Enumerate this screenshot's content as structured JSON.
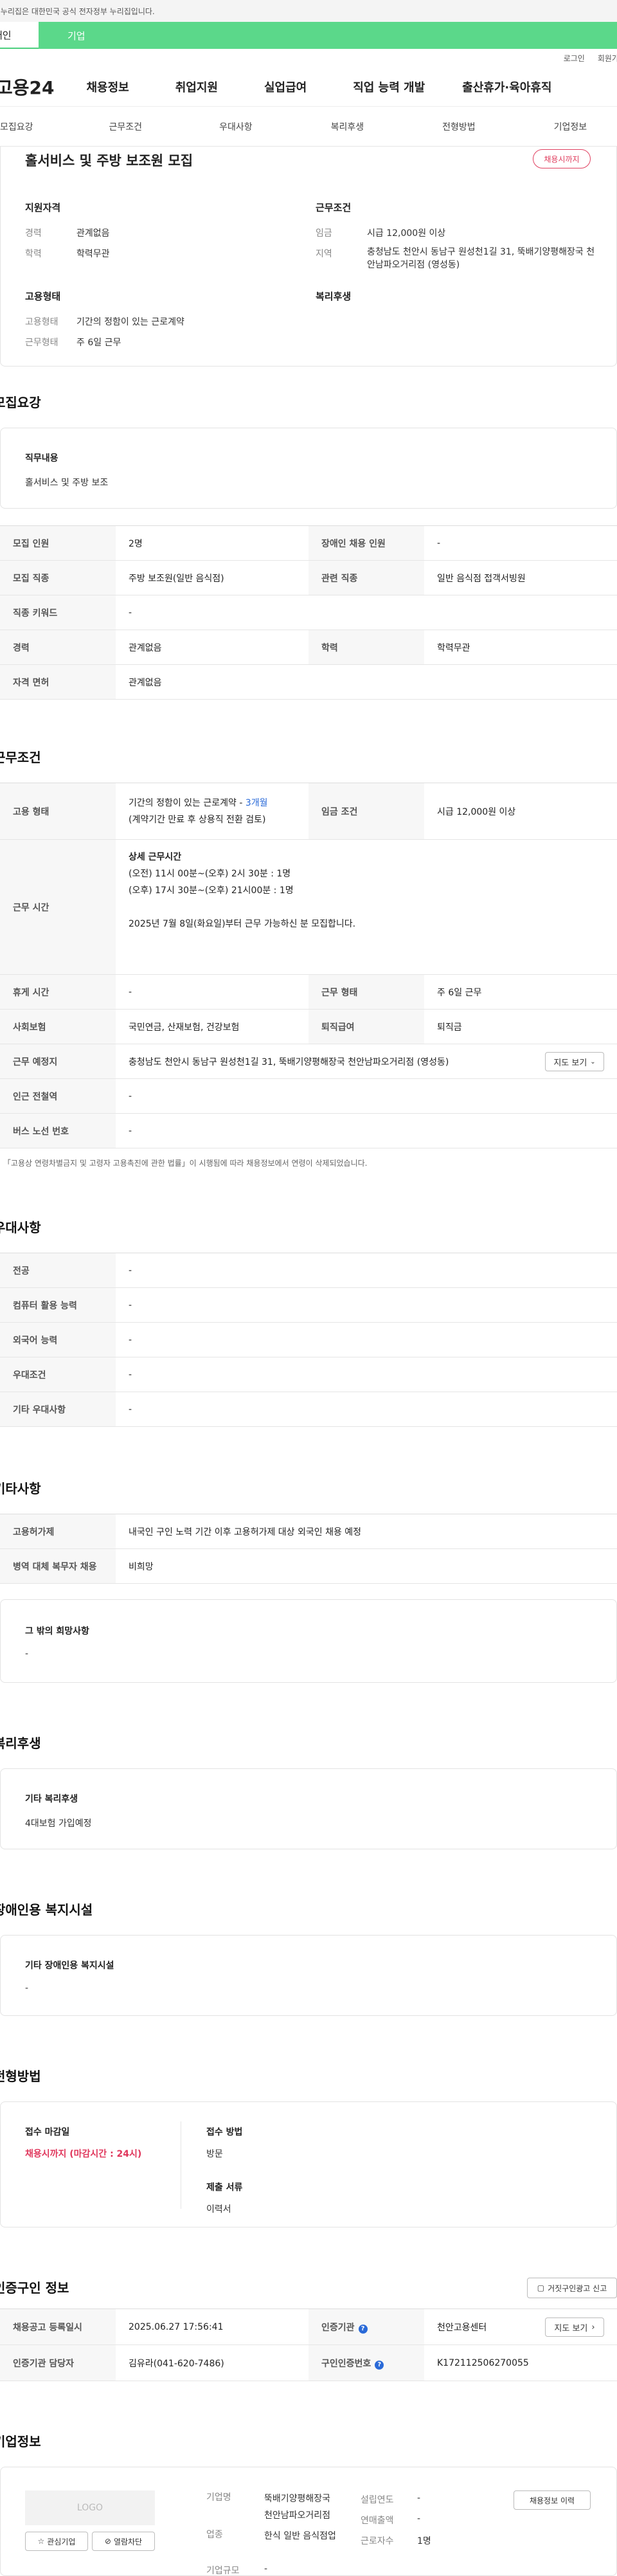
{
  "banner": {
    "text": "이 누리집은 대한민국 공식 전자정부 누리집입니다."
  },
  "loginbar": {
    "person": "개인",
    "company": "기업"
  },
  "util": {
    "login": "로그인",
    "join": "회원가입"
  },
  "gnb": {
    "logo": "고용24",
    "items": [
      "채용정보",
      "취업지원",
      "실업급여",
      "직업 능력 개발",
      "출산휴가·육아휴직"
    ]
  },
  "tabs": [
    "모집요강",
    "근무조건",
    "우대사항",
    "복리후생",
    "전형방법",
    "기업정보"
  ],
  "summary": {
    "title": "홀서비스 및 주방 보조원 모집",
    "badge": "채용시까지",
    "qual_title": "지원자격",
    "career_label": "경력",
    "career_value": "관계없음",
    "edu_label": "학력",
    "edu_value": "학력무관",
    "work_title": "근무조건",
    "wage_label": "임금",
    "wage_value": "시급 12,000원 이상",
    "loc_label": "지역",
    "loc_value": "충청남도 천안시 동남구 원성천1길 31, 뚝배기양평해장국 천안남파오거리점 (영성동)",
    "emp_title": "고용형태",
    "emp_label": "고용형태",
    "emp_value": "기간의 정함이 있는 근로계약",
    "form_label": "근무형태",
    "form_value": "주 6일 근무",
    "welfare_title": "복리후생"
  },
  "recruit": {
    "section_title": "모집요강",
    "duty_title": "직무내용",
    "duty_value": "홀서비스 및 주방 보조",
    "rows": [
      {
        "l1": "모집 인원",
        "v1": "2명",
        "l2": "장애인 채용 인원",
        "v2": "-"
      },
      {
        "l1": "모집 직종",
        "v1": "주방 보조원(일반 음식점)",
        "l2": "관련 직종",
        "v2": "일반 음식점 접객서빙원"
      },
      {
        "l1": "직종 키워드",
        "v1": "-"
      },
      {
        "l1": "경력",
        "v1": "관계없음",
        "l2": "학력",
        "v2": "학력무관"
      },
      {
        "l1": "자격 면허",
        "v1": "관계없음"
      }
    ]
  },
  "work": {
    "section_title": "근무조건",
    "emp_label": "고용 형태",
    "emp_value_a": "기간의 정함이 있는 근로계약 - ",
    "emp_value_b": "3개월",
    "emp_value_c": "(계약기간 만료 후 상용직 전환 검토)",
    "wage_label": "임금 조건",
    "wage_value": "시급 12,000원 이상",
    "time_label": "근무 시간",
    "time_title": "상세 근무시간",
    "time_1": "(오전) 11시 00분~(오후) 2시 30분 : 1명",
    "time_2": "(오후) 17시 30분~(오후) 21시00분 : 1명",
    "time_3": "2025년 7월 8일(화요일)부터 근무 가능하신 분 모집합니다.",
    "rest_label": "휴게 시간",
    "rest_value": "-",
    "form_label": "근무 형태",
    "form_value": "주 6일 근무",
    "insure_label": "사회보험",
    "insure_value": "국민연금, 산재보험, 건강보험",
    "retire_label": "퇴직급여",
    "retire_value": "퇴직금",
    "place_label": "근무 예정지",
    "place_value": "충청남도 천안시 동남구 원성천1길 31, 뚝배기양평해장국 천안남파오거리점 (영성동)",
    "map_btn": "지도 보기",
    "subway_label": "인근 전철역",
    "subway_value": "-",
    "bus_label": "버스 노선 번호",
    "bus_value": "-",
    "notice": "「고용상 연령차별금지 및 고령자 고용촉진에 관한 법률」이 시행됨에 따라 채용정보에서 연령이 삭제되었습니다."
  },
  "prefer": {
    "section_title": "우대사항",
    "rows": [
      {
        "l": "전공",
        "v": "-"
      },
      {
        "l": "컴퓨터 활용 능력",
        "v": "-"
      },
      {
        "l": "외국어 능력",
        "v": "-"
      },
      {
        "l": "우대조건",
        "v": "-"
      },
      {
        "l": "기타 우대사항",
        "v": "-"
      }
    ]
  },
  "etc": {
    "section_title": "기타사항",
    "rows": [
      {
        "l": "고용허가제",
        "v": "내국인 구인 노력 기간 이후 고용허가제 대상 외국인 채용 예정"
      },
      {
        "l": "병역 대체 복무자 채용",
        "v": "비희망"
      }
    ],
    "hope_title": "그 밖의 희망사항",
    "hope_value": "-"
  },
  "welfare": {
    "section_title": "복리후생",
    "card_title": "기타 복리후생",
    "card_value": "4대보험 가입예정"
  },
  "disabled": {
    "section_title": "장애인용 복지시설",
    "card_title": "기타 장애인용 복지시설",
    "card_value": "-"
  },
  "process": {
    "section_title": "전형방법",
    "deadline_title": "접수 마감일",
    "deadline_value": "채용시까지 (마감시간 : 24시)",
    "method_title": "접수 방법",
    "method_value": "방문",
    "doc_title": "제출 서류",
    "doc_value": "이력서"
  },
  "cert": {
    "section_title": "인증구인 정보",
    "report_btn": "거짓구인광고 신고",
    "reg_label": "채용공고 등록일시",
    "reg_value": "2025.06.27 17:56:41",
    "org_label": "인증기관",
    "org_value": "천안고용센터",
    "map_btn": "지도 보기",
    "mgr_label": "인증기관 담당자",
    "mgr_value": "김유라(041-620-7486)",
    "num_label": "구인인증번호",
    "num_value": "K172112506270055"
  },
  "company": {
    "section_title": "기업정보",
    "logo_text": "LOGO",
    "fav_btn": "관심기업",
    "block_btn": "열람차단",
    "name_label": "기업명",
    "name_value": "뚝배기양평해장국 천안남파오거리점",
    "industry_label": "업종",
    "industry_value": "한식 일반 음식점업",
    "size_label": "기업규모",
    "size_value": "-",
    "year_label": "설립연도",
    "year_value": "-",
    "sales_label": "연매출액",
    "sales_value": "-",
    "staff_label": "근로자수",
    "staff_value": "1명",
    "history_btn": "채용정보 이력"
  }
}
